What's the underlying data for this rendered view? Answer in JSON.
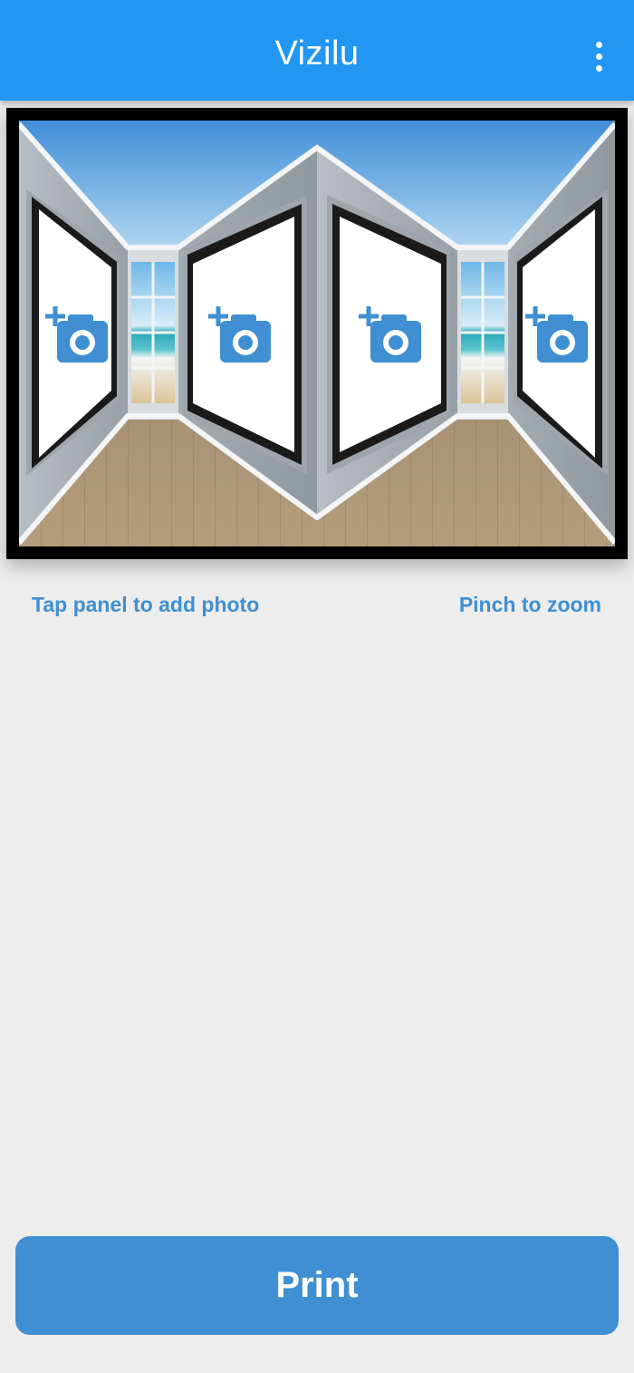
{
  "app_bar": {
    "title": "Vizilu",
    "menu_icon": "more-vertical-icon"
  },
  "preview": {
    "panels": [
      {
        "id": "panel-1",
        "icon": "add-photo-camera-icon"
      },
      {
        "id": "panel-2",
        "icon": "add-photo-camera-icon"
      },
      {
        "id": "panel-3",
        "icon": "add-photo-camera-icon"
      },
      {
        "id": "panel-4",
        "icon": "add-photo-camera-icon"
      }
    ]
  },
  "hints": {
    "left": "Tap panel to add photo",
    "right": "Pinch to zoom"
  },
  "actions": {
    "print_label": "Print"
  },
  "colors": {
    "app_bar": "#2196f3",
    "accent": "#3f8fd2",
    "background": "#ededed"
  }
}
